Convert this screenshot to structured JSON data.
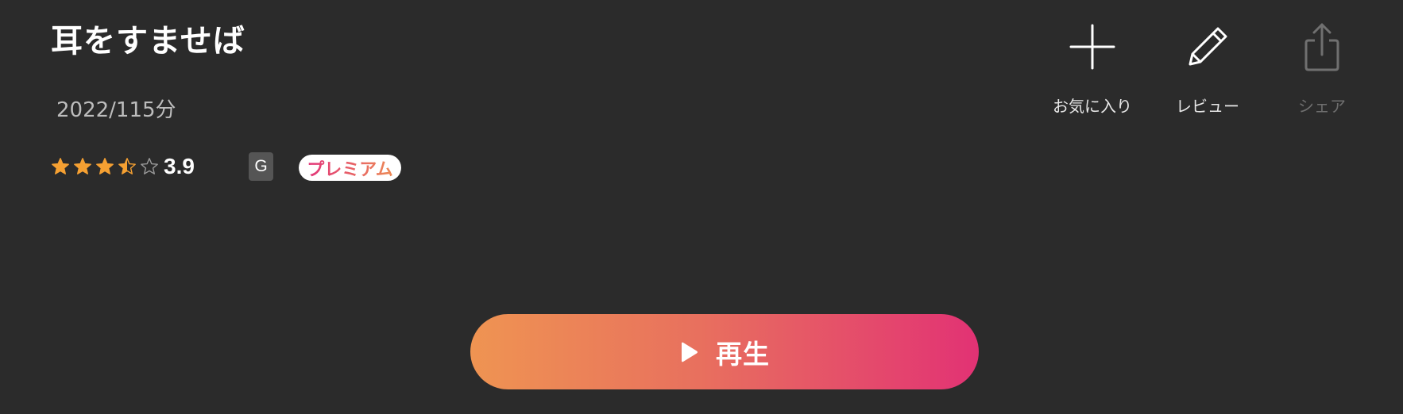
{
  "movie": {
    "title": "耳をすませば",
    "meta": "2022/115分",
    "rating": {
      "value": "3.9",
      "stars": [
        1,
        1,
        1,
        0.5,
        0
      ]
    },
    "age_rating": "G",
    "premium_label": "プレミアム"
  },
  "actions": {
    "favorite": {
      "label": "お気に入り",
      "icon": "plus-icon"
    },
    "review": {
      "label": "レビュー",
      "icon": "pencil-icon"
    },
    "share": {
      "label": "シェア",
      "icon": "share-icon",
      "disabled": true
    }
  },
  "play": {
    "label": "再生",
    "icon": "play-icon"
  },
  "colors": {
    "background": "#2b2b2b",
    "star": "#f5a032",
    "gradient_start": "#ef9452",
    "gradient_end": "#e23274"
  }
}
